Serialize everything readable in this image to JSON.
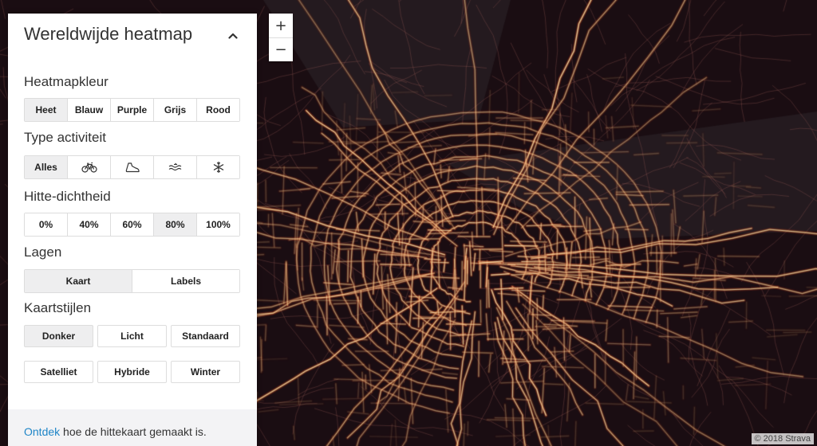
{
  "panel": {
    "title": "Wereldwijde heatmap",
    "collapse_icon": "chevron-up-icon"
  },
  "heatmap_color": {
    "label": "Heatmapkleur",
    "options": [
      "Heet",
      "Blauw",
      "Purple",
      "Grijs",
      "Rood"
    ],
    "selected": "Heet"
  },
  "activity_type": {
    "label": "Type activiteit",
    "options": [
      {
        "label": "Alles",
        "icon": null
      },
      {
        "label": null,
        "icon": "bike-icon"
      },
      {
        "label": null,
        "icon": "shoe-icon"
      },
      {
        "label": null,
        "icon": "water-icon"
      },
      {
        "label": null,
        "icon": "snowflake-icon"
      }
    ],
    "selected": "Alles"
  },
  "heat_density": {
    "label": "Hitte-dichtheid",
    "options": [
      "0%",
      "40%",
      "60%",
      "80%",
      "100%"
    ],
    "selected": "80%"
  },
  "layers": {
    "label": "Lagen",
    "options": [
      "Kaart",
      "Labels"
    ],
    "selected": "Kaart"
  },
  "map_styles": {
    "label": "Kaartstijlen",
    "options": [
      "Donker",
      "Licht",
      "Standaard",
      "Satelliet",
      "Hybride",
      "Winter"
    ],
    "selected": "Donker"
  },
  "footer": {
    "link_text": "Ontdek",
    "text": " hoe de hittekaart gemaakt is."
  },
  "zoom": {
    "in_label": "+",
    "out_label": "−"
  },
  "attribution": "© 2018 Strava",
  "colors": {
    "map_background": "#1a0d12",
    "heat_core": "#fff4d6",
    "heat_mid": "#ffbe5a",
    "heat_low": "#a32a1c",
    "link": "#1e85c7",
    "active_button": "#eeeeef"
  }
}
